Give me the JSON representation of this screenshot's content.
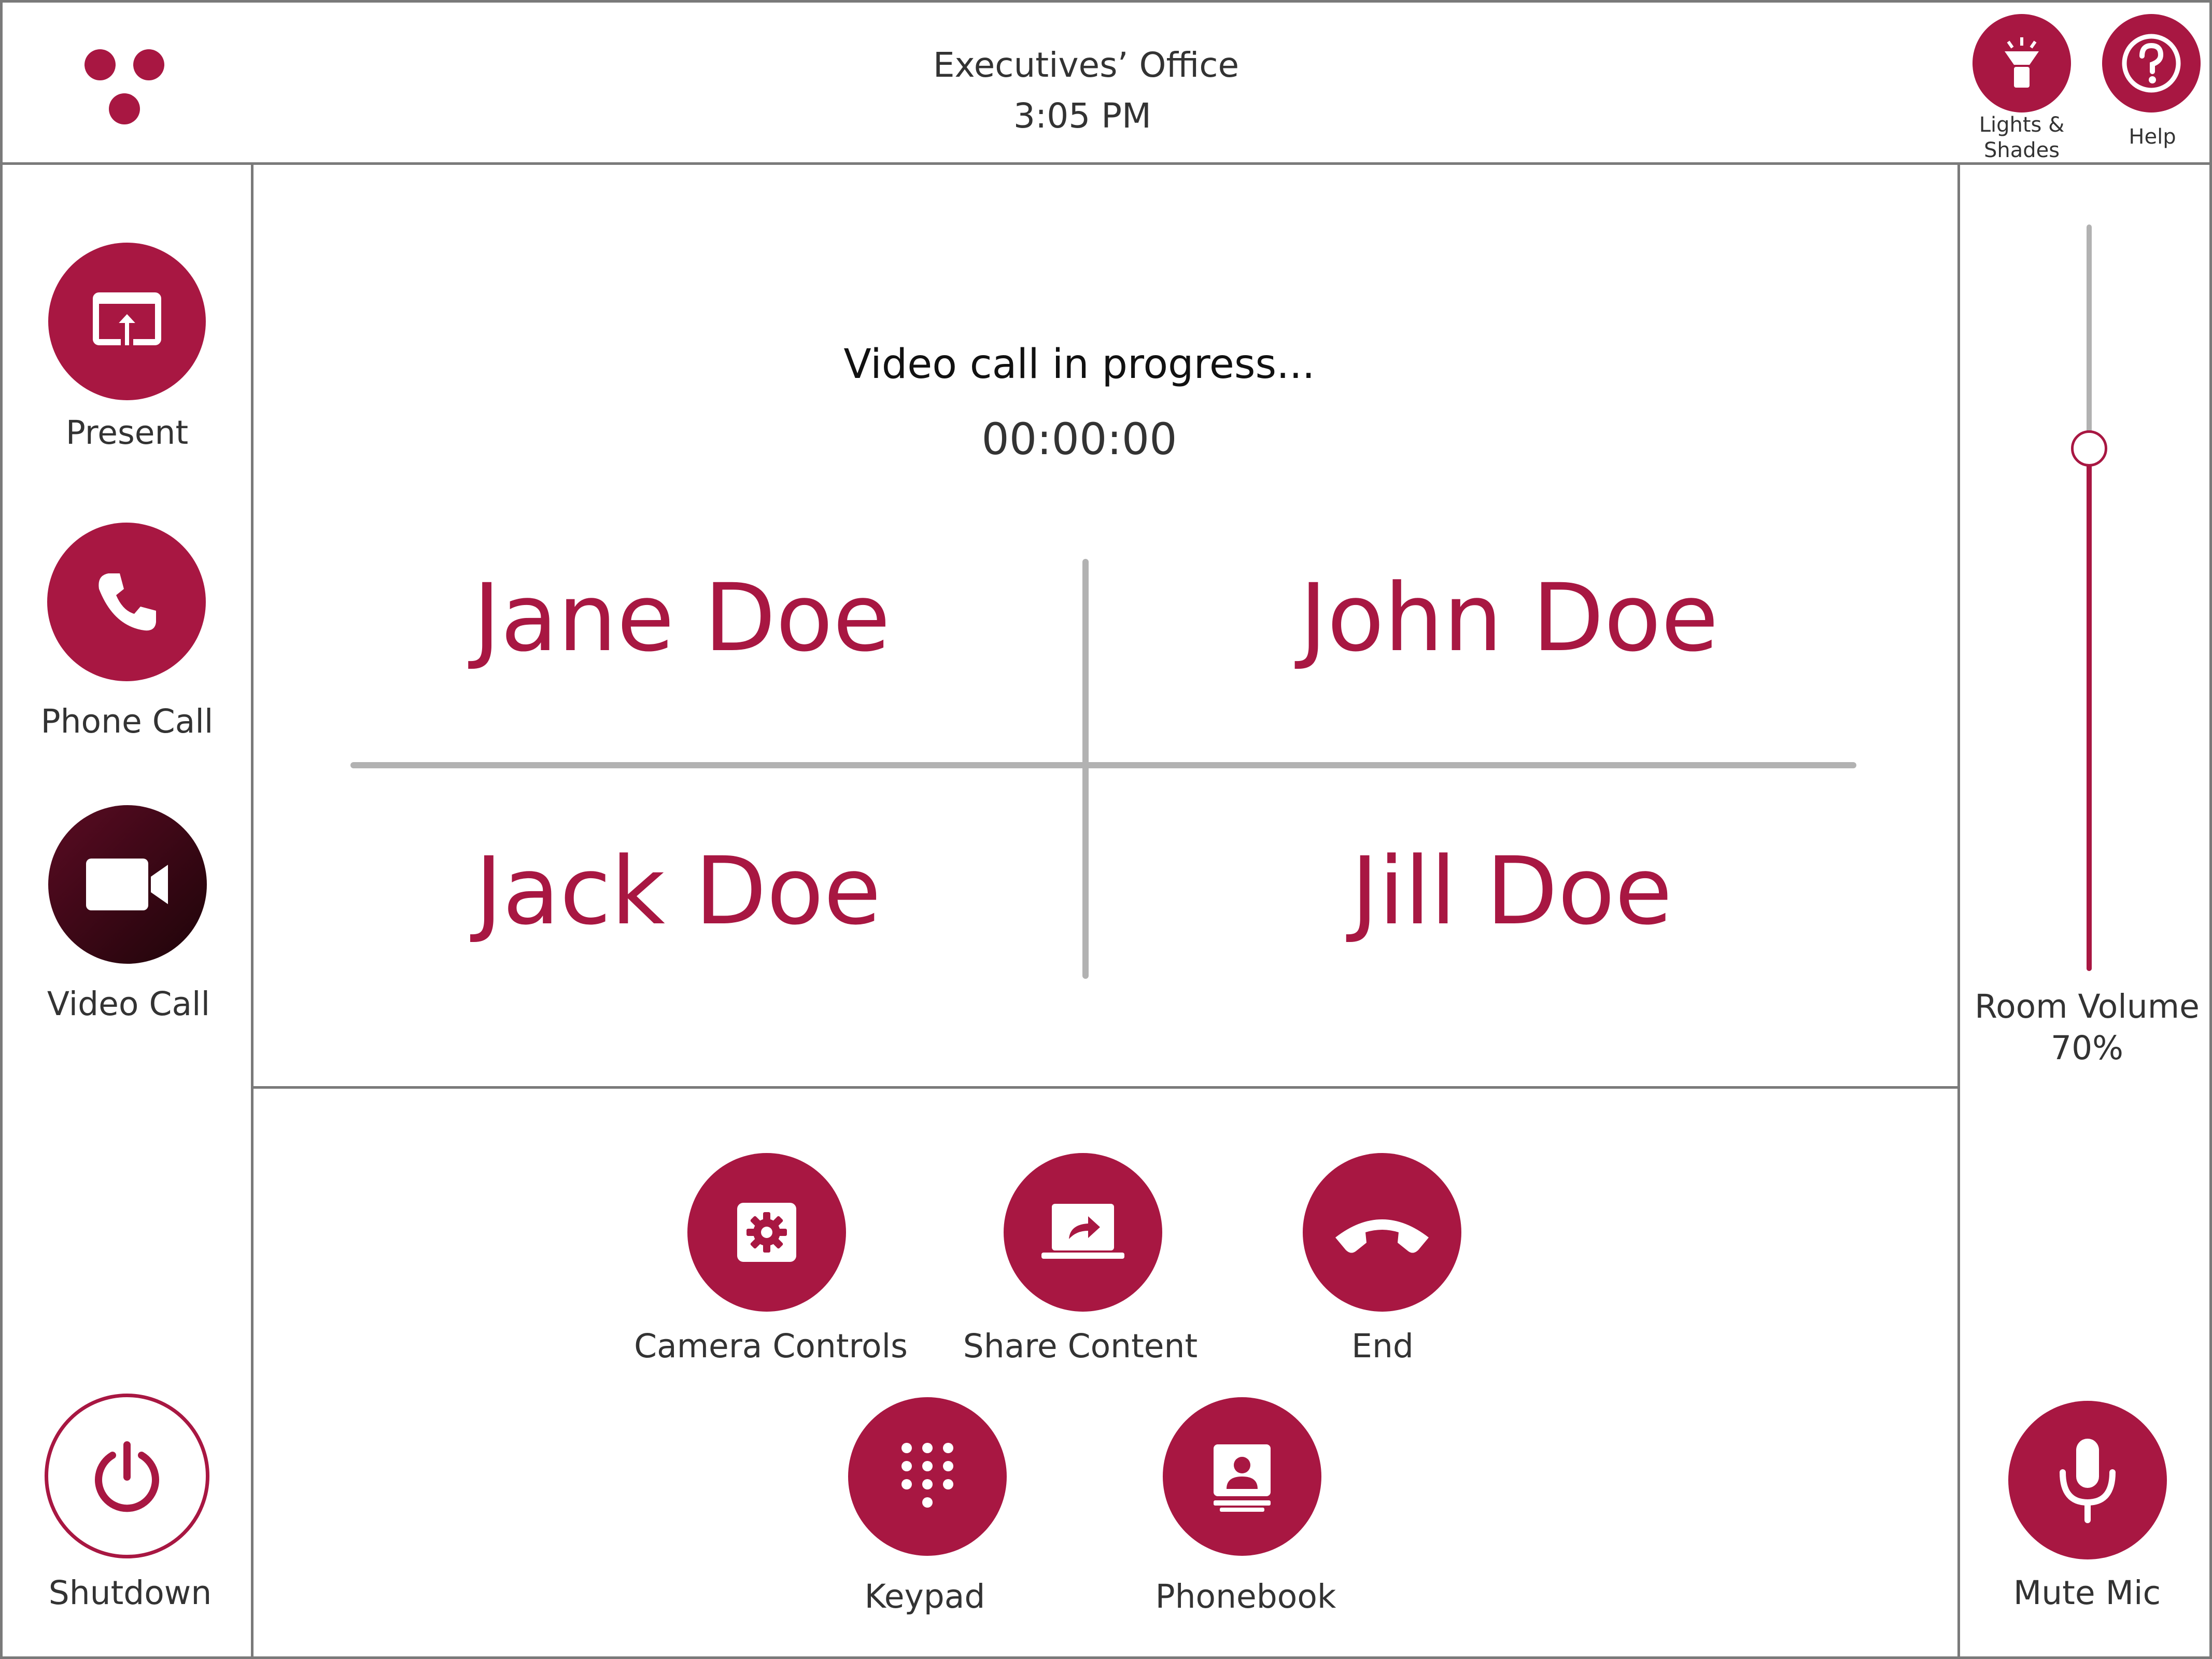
{
  "header": {
    "room_name": "Executives’ Office",
    "time": "3:05 PM",
    "lights_label_line1": "Lights &",
    "lights_label_line2": "Shades",
    "help_label": "Help",
    "logo_icon": "three-dots-logo-icon",
    "lights_icon": "lamp-icon",
    "help_icon": "question-icon"
  },
  "sidebar": {
    "items": [
      {
        "label": "Present",
        "icon": "present-screen-icon",
        "active": false
      },
      {
        "label": "Phone Call",
        "icon": "phone-icon",
        "active": false
      },
      {
        "label": "Video Call",
        "icon": "video-camera-icon",
        "active": true
      }
    ],
    "shutdown_label": "Shutdown",
    "shutdown_icon": "power-icon"
  },
  "call": {
    "status": "Video call in progress...",
    "timer": "00:00:00",
    "participants": [
      "Jane Doe",
      "John Doe",
      "Jack Doe",
      "Jill Doe"
    ]
  },
  "controls": {
    "camera_controls": "Camera Controls",
    "share_content": "Share Content",
    "end": "End",
    "keypad": "Keypad",
    "phonebook": "Phonebook"
  },
  "volume": {
    "label": "Room Volume",
    "value_text": "70%",
    "level": 0.7,
    "mute_label": "Mute Mic",
    "mute_icon": "microphone-icon"
  },
  "colors": {
    "accent": "#a81742",
    "active_dark": "#3d0818",
    "border": "#7a7a7a",
    "divider": "#b2b2b2"
  }
}
